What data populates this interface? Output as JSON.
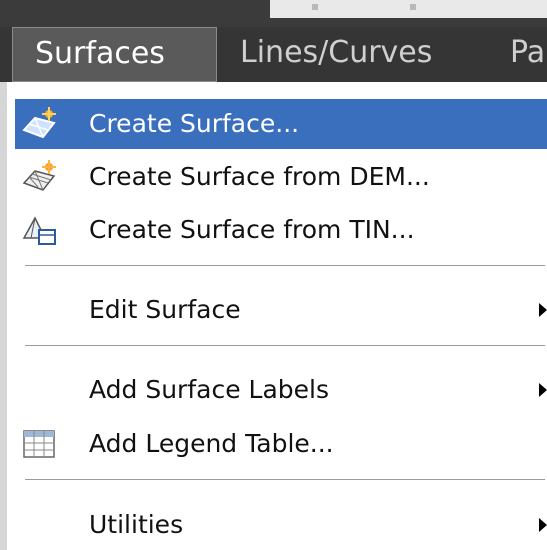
{
  "menubar": {
    "items": [
      {
        "label": "Surfaces"
      },
      {
        "label": "Lines/Curves"
      },
      {
        "label": "Pa"
      }
    ]
  },
  "menu": {
    "items": [
      {
        "label": "Create Surface...",
        "icon": "create-surface-icon",
        "highlighted": true
      },
      {
        "label": "Create Surface from DEM...",
        "icon": "surface-from-dem-icon"
      },
      {
        "label": "Create Surface from TIN...",
        "icon": "surface-from-tin-icon"
      },
      {
        "label": "Edit Surface",
        "submenu": true
      },
      {
        "label": "Add Surface Labels",
        "submenu": true
      },
      {
        "label": "Add Legend Table...",
        "icon": "legend-table-icon"
      },
      {
        "label": "Utilities",
        "submenu": true
      }
    ]
  },
  "colors": {
    "highlight": "#3a6fbe",
    "menubar_bg": "#353535"
  }
}
